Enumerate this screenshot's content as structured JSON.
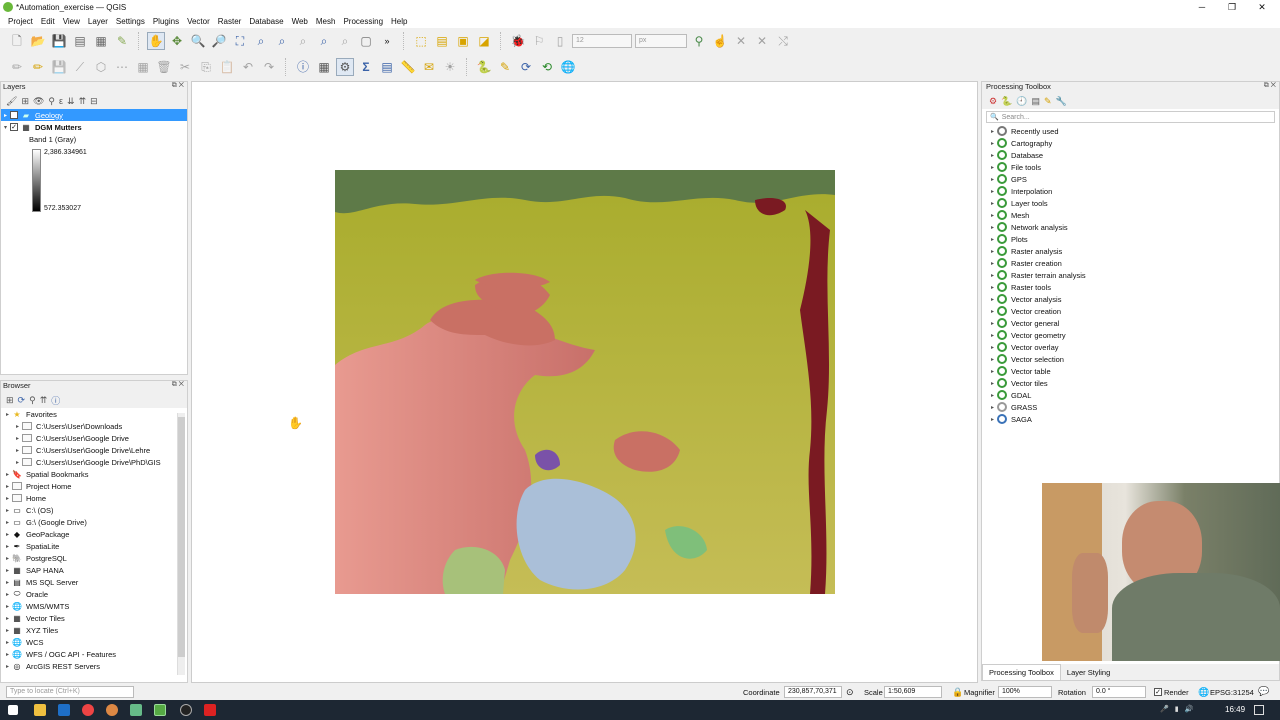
{
  "window": {
    "title": "*Automation_exercise — QGIS",
    "minimize": "─",
    "restore": "❐",
    "close": "✕"
  },
  "menu": [
    "Project",
    "Edit",
    "View",
    "Layer",
    "Settings",
    "Plugins",
    "Vector",
    "Raster",
    "Database",
    "Web",
    "Mesh",
    "Processing",
    "Help"
  ],
  "toolbar": {
    "font_size_value": "12",
    "unit_value": "px"
  },
  "layers_panel": {
    "title": "Layers",
    "items": [
      {
        "name": "Geology",
        "checked": "✓",
        "selected": true
      },
      {
        "name": "DGM Mutters",
        "checked": "✓",
        "selected": false
      }
    ],
    "band_label": "Band 1 (Gray)",
    "legend_max": "2,386.334961",
    "legend_min": "572.353027"
  },
  "browser_panel": {
    "title": "Browser",
    "items": [
      {
        "label": "Favorites",
        "indent": 0,
        "icon": "star-icon"
      },
      {
        "label": "C:\\Users\\User\\Downloads",
        "indent": 1,
        "icon": "folder-icon"
      },
      {
        "label": "C:\\Users\\User\\Google Drive",
        "indent": 1,
        "icon": "folder-icon"
      },
      {
        "label": "C:\\Users\\User\\Google Drive\\Lehre",
        "indent": 1,
        "icon": "folder-icon"
      },
      {
        "label": "C:\\Users\\User\\Google Drive\\PhD\\GIS",
        "indent": 1,
        "icon": "folder-icon"
      },
      {
        "label": "Spatial Bookmarks",
        "indent": 0,
        "icon": "bookmark-icon"
      },
      {
        "label": "Project Home",
        "indent": 0,
        "icon": "folder-icon"
      },
      {
        "label": "Home",
        "indent": 0,
        "icon": "folder-icon"
      },
      {
        "label": "C:\\ (OS)",
        "indent": 0,
        "icon": "drive-icon"
      },
      {
        "label": "G:\\ (Google Drive)",
        "indent": 0,
        "icon": "drive-icon"
      },
      {
        "label": "GeoPackage",
        "indent": 0,
        "icon": "geopackage-icon"
      },
      {
        "label": "SpatiaLite",
        "indent": 0,
        "icon": "spatialite-icon"
      },
      {
        "label": "PostgreSQL",
        "indent": 0,
        "icon": "postgresql-icon"
      },
      {
        "label": "SAP HANA",
        "indent": 0,
        "icon": "sap-hana-icon"
      },
      {
        "label": "MS SQL Server",
        "indent": 0,
        "icon": "mssql-icon"
      },
      {
        "label": "Oracle",
        "indent": 0,
        "icon": "oracle-icon"
      },
      {
        "label": "WMS/WMTS",
        "indent": 0,
        "icon": "wms-icon"
      },
      {
        "label": "Vector Tiles",
        "indent": 0,
        "icon": "vector-tiles-icon"
      },
      {
        "label": "XYZ Tiles",
        "indent": 0,
        "icon": "xyz-tiles-icon"
      },
      {
        "label": "WCS",
        "indent": 0,
        "icon": "wcs-icon"
      },
      {
        "label": "WFS / OGC API - Features",
        "indent": 0,
        "icon": "wfs-icon"
      },
      {
        "label": "ArcGIS REST Servers",
        "indent": 0,
        "icon": "arcgis-icon"
      }
    ]
  },
  "processing": {
    "title": "Processing Toolbox",
    "search_placeholder": "Search...",
    "items": [
      "Recently used",
      "Cartography",
      "Database",
      "File tools",
      "GPS",
      "Interpolation",
      "Layer tools",
      "Mesh",
      "Network analysis",
      "Plots",
      "Raster analysis",
      "Raster creation",
      "Raster terrain analysis",
      "Raster tools",
      "Vector analysis",
      "Vector creation",
      "Vector general",
      "Vector geometry",
      "Vector overlay",
      "Vector selection",
      "Vector table",
      "Vector tiles",
      "GDAL",
      "GRASS",
      "SAGA"
    ],
    "tabs": [
      "Processing Toolbox",
      "Layer Styling"
    ]
  },
  "statusbar": {
    "locate_placeholder": "Type to locate (Ctrl+K)",
    "coordinate_label": "Coordinate",
    "coordinate_value": "230,857,70,371",
    "scale_label": "Scale",
    "scale_value": "1:50,609",
    "magnifier_label": "Magnifier",
    "magnifier_value": "100%",
    "rotation_label": "Rotation",
    "rotation_value": "0.0 °",
    "render_label": "Render",
    "crs_label": "EPSG:31254"
  },
  "taskbar": {
    "time": "16:49"
  },
  "colors": {
    "selection": "#3399ff",
    "geology_base": "#a6ab2e",
    "geology_red": "#c97064",
    "geology_dark": "#7a1a22",
    "geology_blue": "#aabfd8",
    "taskbar": "#1d2733"
  }
}
